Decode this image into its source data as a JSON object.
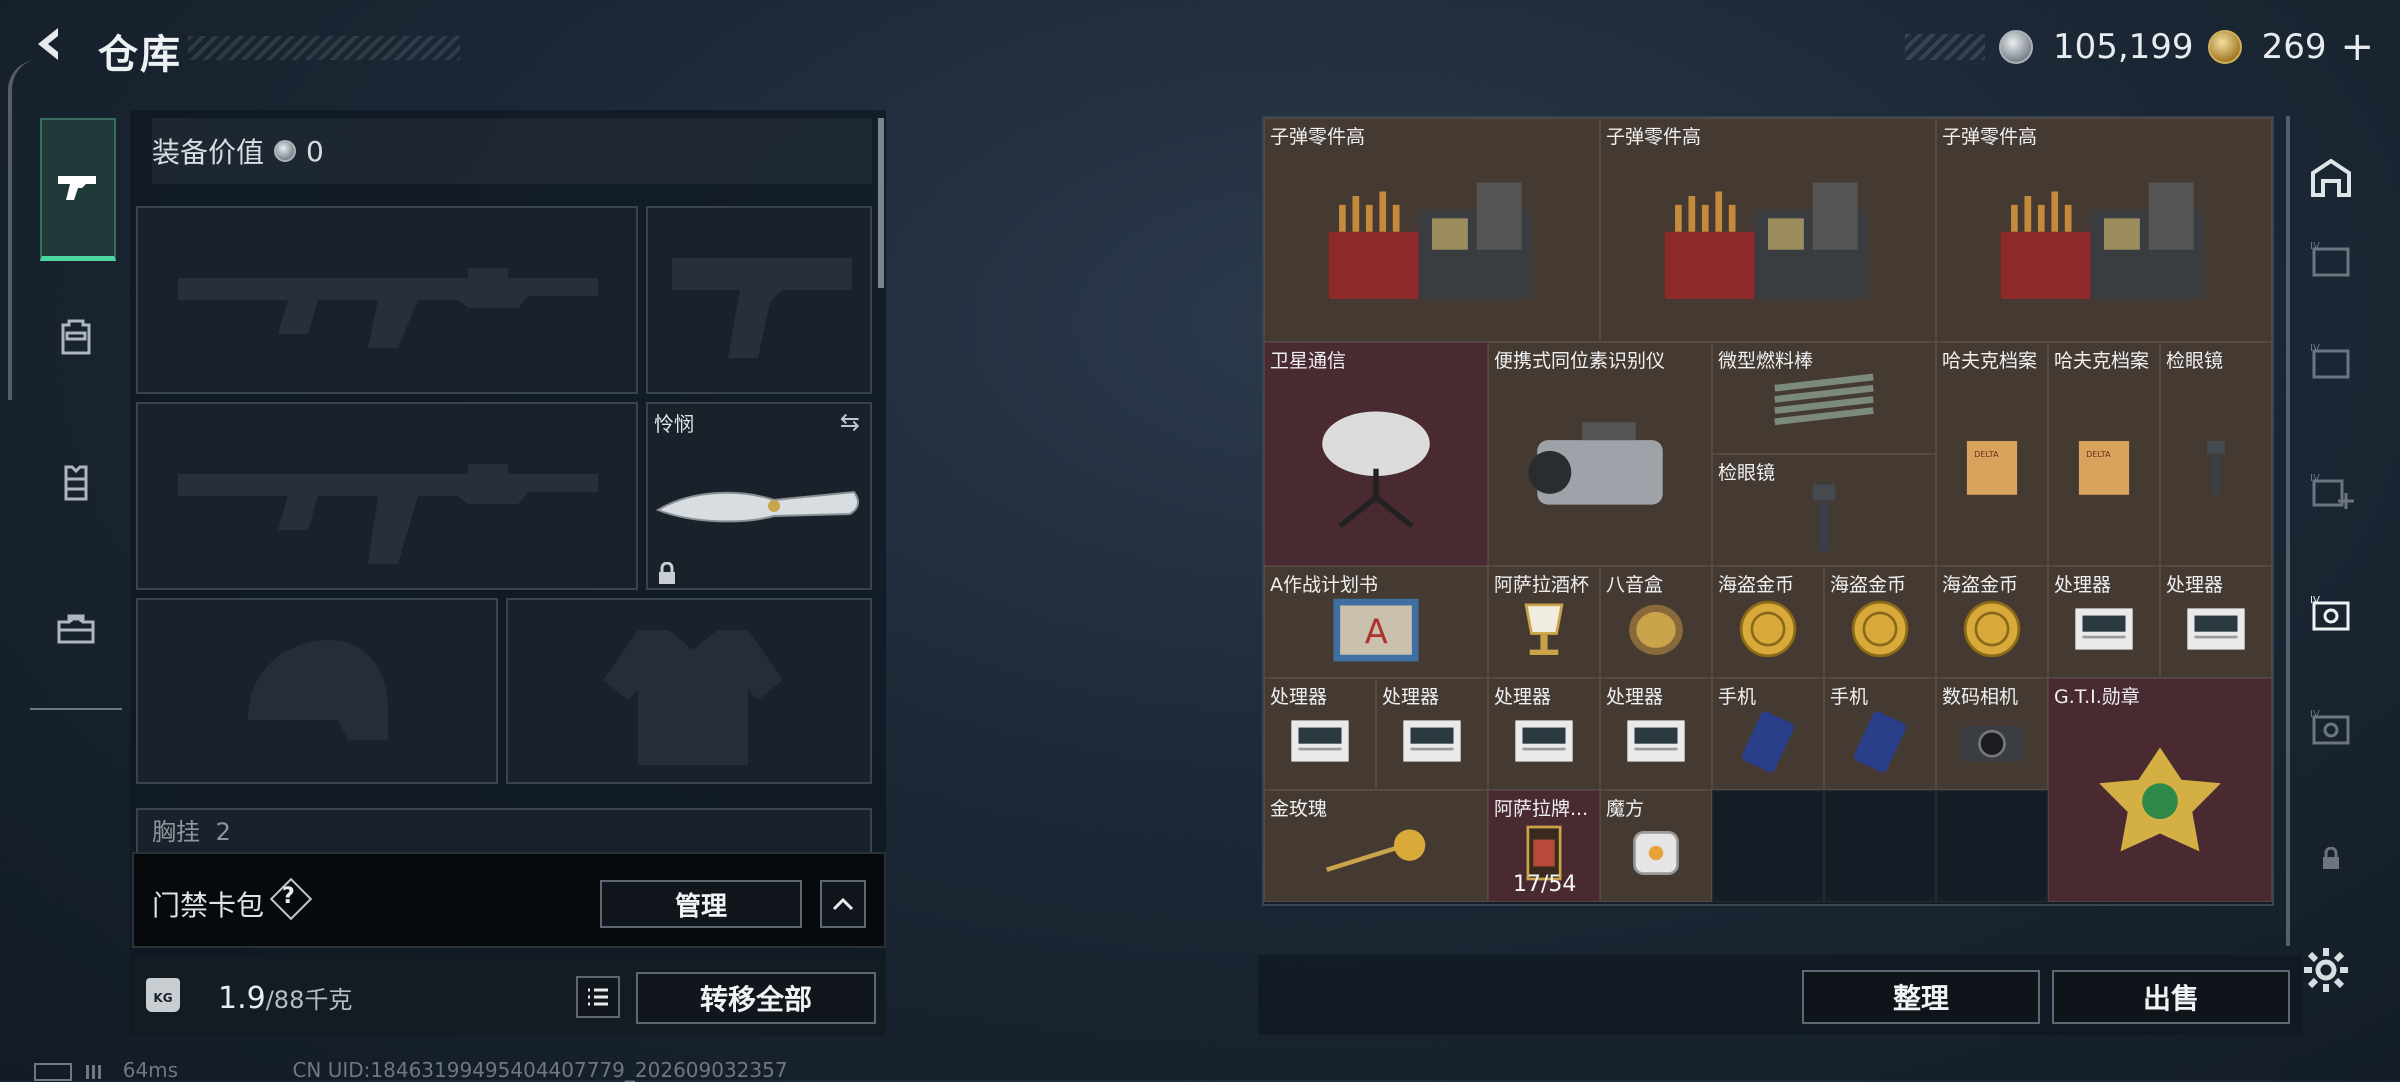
{
  "header": {
    "title": "仓库",
    "currency_silver": "105,199",
    "currency_gold": "269",
    "add_symbol": "+"
  },
  "equipment": {
    "value_label": "装备价值",
    "value_amount": "0",
    "melee_name": "怜悯",
    "chest_label": "胸挂",
    "chest_count": "2"
  },
  "card_pack": {
    "label": "门禁卡包",
    "help": "?",
    "manage_label": "管理"
  },
  "weight": {
    "current": "1.9",
    "capacity": "/88千克",
    "kg_icon_text": "KG",
    "transfer_label": "转移全部"
  },
  "status": {
    "ping": "64ms",
    "uid": "CN UID:18463199495404407779_202609032357"
  },
  "storage": {
    "sort_label": "整理",
    "sell_label": "出售",
    "items": [
      {
        "name": "子弹零件高",
        "color": "brown",
        "icon": "ammo-parts-icon"
      },
      {
        "name": "子弹零件高",
        "color": "brown",
        "icon": "ammo-parts-icon"
      },
      {
        "name": "子弹零件高",
        "color": "brown",
        "icon": "ammo-parts-icon"
      },
      {
        "name": "卫星通信",
        "color": "red",
        "icon": "satellite-dish-icon"
      },
      {
        "name": "便携式同位素识别仪",
        "color": "brown",
        "icon": "isotope-scanner-icon"
      },
      {
        "name": "微型燃料棒",
        "color": "brown",
        "icon": "fuel-rods-icon"
      },
      {
        "name": "检眼镜",
        "color": "brown",
        "icon": "ophthalmoscope-icon"
      },
      {
        "name": "哈夫克档案",
        "color": "brown",
        "icon": "file-folder-icon"
      },
      {
        "name": "哈夫克档案",
        "color": "brown",
        "icon": "file-folder-icon"
      },
      {
        "name": "检眼镜",
        "color": "brown",
        "icon": "ophthalmoscope-icon"
      },
      {
        "name": "A作战计划书",
        "color": "brown",
        "icon": "plan-book-icon"
      },
      {
        "name": "阿萨拉酒杯",
        "color": "brown",
        "icon": "goblet-icon"
      },
      {
        "name": "八音盒",
        "color": "brown",
        "icon": "music-box-icon"
      },
      {
        "name": "海盗金币",
        "color": "brown",
        "icon": "gold-coin-icon"
      },
      {
        "name": "海盗金币",
        "color": "brown",
        "icon": "gold-coin-icon"
      },
      {
        "name": "海盗金币",
        "color": "brown",
        "icon": "gold-coin-icon"
      },
      {
        "name": "处理器",
        "color": "brown",
        "icon": "processor-icon"
      },
      {
        "name": "处理器",
        "color": "brown",
        "icon": "processor-icon"
      },
      {
        "name": "处理器",
        "color": "brown",
        "icon": "processor-icon"
      },
      {
        "name": "处理器",
        "color": "brown",
        "icon": "processor-icon"
      },
      {
        "name": "处理器",
        "color": "brown",
        "icon": "processor-icon"
      },
      {
        "name": "处理器",
        "color": "brown",
        "icon": "processor-icon"
      },
      {
        "name": "手机",
        "color": "brown",
        "icon": "phone-icon"
      },
      {
        "name": "手机",
        "color": "brown",
        "icon": "phone-icon"
      },
      {
        "name": "数码相机",
        "color": "brown",
        "icon": "camera-icon"
      },
      {
        "name": "G.T.I.勋章",
        "color": "red",
        "icon": "medal-icon"
      },
      {
        "name": "金玫瑰",
        "color": "brown",
        "icon": "gold-rose-icon"
      },
      {
        "name": "阿萨拉牌...",
        "color": "red",
        "icon": "cigarette-pack-icon",
        "count": "17/54"
      },
      {
        "name": "魔方",
        "color": "brown",
        "icon": "cube-icon"
      }
    ]
  },
  "colors": {
    "accent_green": "#4bd6a2",
    "item_brown": "#453a31",
    "item_red": "#4a2a31"
  }
}
